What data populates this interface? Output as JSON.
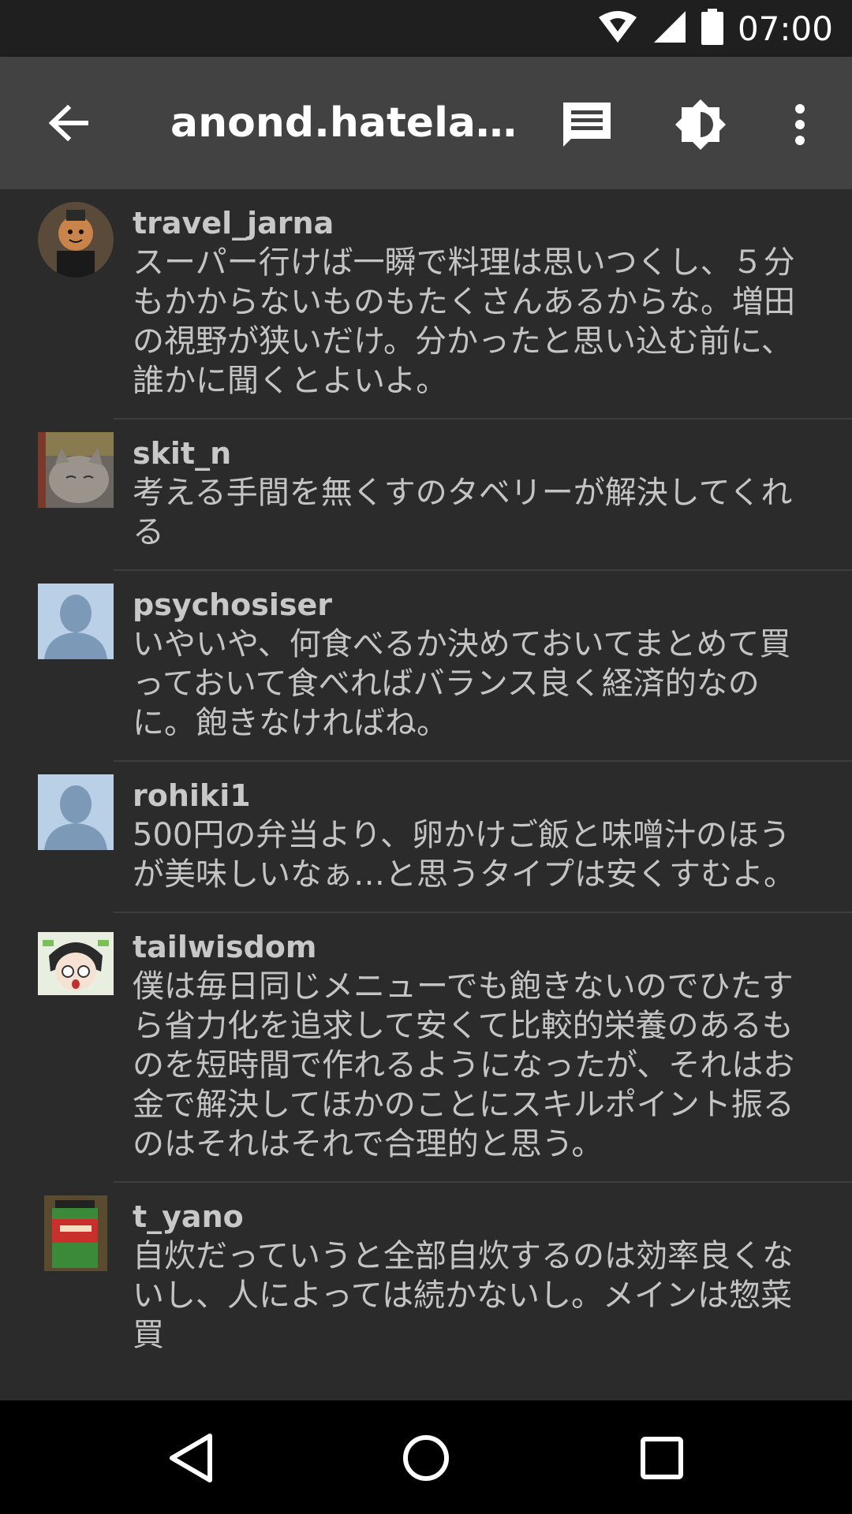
{
  "status_bar": {
    "time": "07:00",
    "icons": [
      "wifi-icon",
      "signal-icon",
      "battery-icon"
    ]
  },
  "app_bar": {
    "title": "anond.hatelab…",
    "icons": [
      "back-arrow-icon",
      "comment-icon",
      "brightness-icon",
      "more-vert-icon"
    ]
  },
  "comments": [
    {
      "user": "travel_jarna",
      "text": "スーパー行けば一瞬で料理は思いつくし、５分もかからないものもたくさんあるからな。増田の視野が狭いだけ。分かったと思い込む前に、誰かに聞くとよいよ。",
      "avatar": "character-avatar"
    },
    {
      "user": "skit_n",
      "text": "考える手間を無くすのタベリーが解決してくれる",
      "avatar": "cat-avatar"
    },
    {
      "user": "psychosiser",
      "text": "いやいや、何食べるか決めておいてまとめて買っておいて食べればバランス良く経済的なのに。飽きなければね。",
      "avatar": "default-avatar"
    },
    {
      "user": "rohiki1",
      "text": "500円の弁当より、卵かけご飯と味噌汁のほうが美味しいなぁ…と思うタイプは安くすむよ。",
      "avatar": "default-avatar"
    },
    {
      "user": "tailwisdom",
      "text": "僕は毎日同じメニューでも飽きないのでひたすら省力化を追求して安くて比較的栄養のあるものを短時間で作れるようになったが、それはお金で解決してほかのことにスキルポイント振るのはそれはそれで合理的と思う。",
      "avatar": "anime-avatar"
    },
    {
      "user": "t_yano",
      "text": "自炊だっていうと全部自炊するのは効率良くないし、人によっては続かないし。メインは惣菜買",
      "avatar": "film-canister-avatar"
    }
  ],
  "nav_bar": {
    "icons": [
      "back-nav-icon",
      "home-nav-icon",
      "recents-nav-icon"
    ]
  },
  "colors": {
    "background": "#2b2b2b",
    "app_bar": "#424242",
    "status_bar": "#1f1f1f",
    "text": "#c4c4c4"
  }
}
